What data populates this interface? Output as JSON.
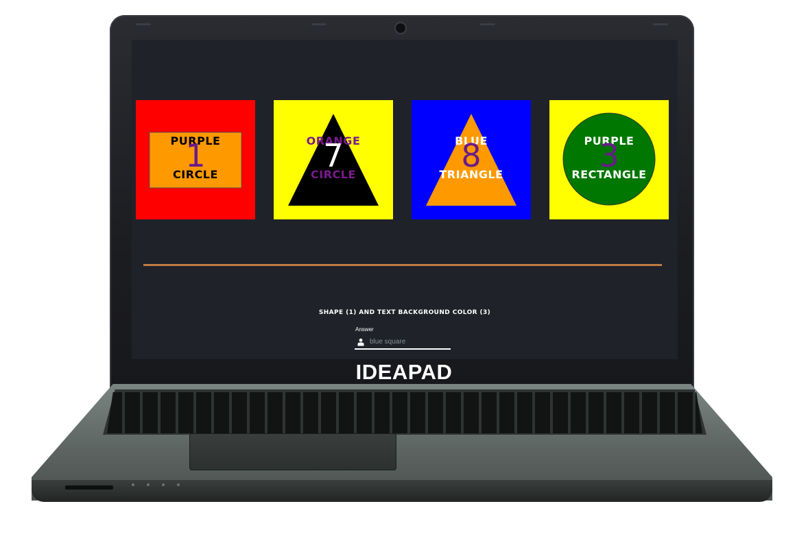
{
  "device": {
    "brand": "IDEAPAD"
  },
  "cards": [
    {
      "background": "#ff0000",
      "shape": "rectangle",
      "shape_color": "#ff9900",
      "top_word": "PURPLE",
      "bottom_word": "CIRCLE",
      "number": "1",
      "word_color": "#000000",
      "number_color": "#6a1b8a"
    },
    {
      "background": "#ffff00",
      "shape": "triangle",
      "shape_color": "#000000",
      "top_word": "ORANGE",
      "bottom_word": "CIRCLE",
      "number": "7",
      "word_color": "#7a1a8c",
      "number_color": "#ffffff"
    },
    {
      "background": "#0000ff",
      "shape": "triangle",
      "shape_color": "#ff9900",
      "top_word": "BLUE",
      "bottom_word": "TRIANGLE",
      "number": "8",
      "word_color": "#ffffff",
      "number_color": "#6a1b8a"
    },
    {
      "background": "#ffff00",
      "shape": "circle",
      "shape_color": "#007700",
      "top_word": "PURPLE",
      "bottom_word": "RECTANGLE",
      "number": "3",
      "word_color": "#ffffff",
      "number_color": "#6a1b8a"
    }
  ],
  "question": "SHAPE (1) AND TEXT BACKGROUND COLOR (3)",
  "answer": {
    "label": "Answer",
    "placeholder": "blue square",
    "value": "",
    "icon": "user-icon"
  },
  "colors": {
    "screen_bg": "#1f2229",
    "divider": "#c07a44"
  }
}
